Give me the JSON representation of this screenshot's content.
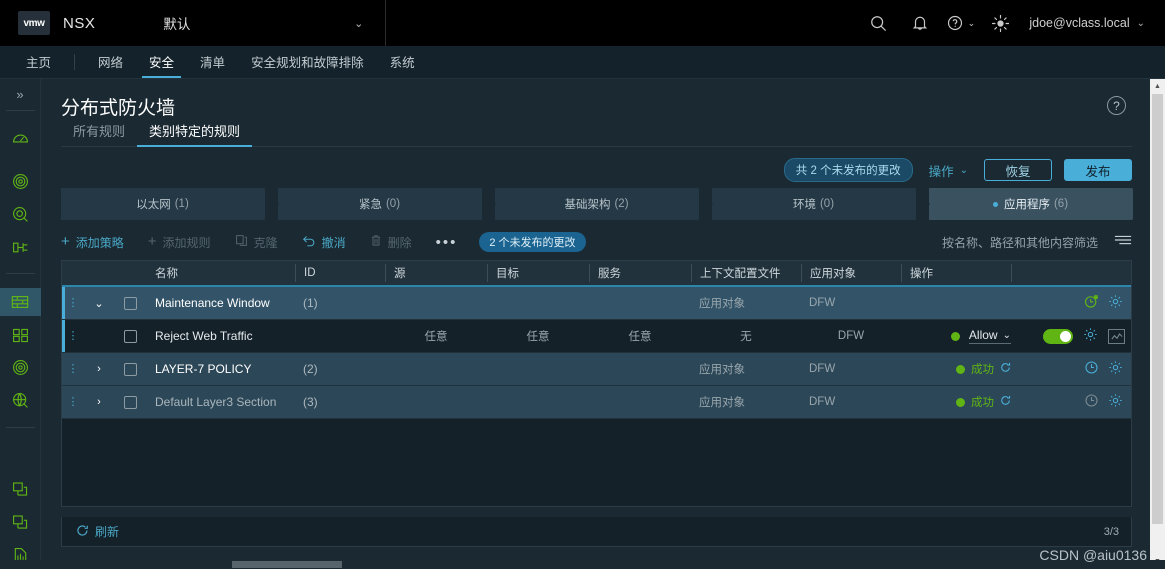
{
  "header": {
    "logo_text": "vmw",
    "app_name": "NSX",
    "context_value": "默认",
    "context_caret": "⌄",
    "icons": [
      {
        "name": "search-icon"
      },
      {
        "name": "bell-icon"
      },
      {
        "name": "help-icon"
      },
      {
        "name": "theme-icon"
      }
    ],
    "user": "jdoe@vclass.local",
    "user_caret": "⌄",
    "help_caret": "⌄"
  },
  "nav": {
    "items": [
      {
        "label": "主页",
        "active": false
      },
      {
        "label": "网络",
        "active": false
      },
      {
        "label": "安全",
        "active": true
      },
      {
        "label": "清单",
        "active": false
      },
      {
        "label": "安全规划和故障排除",
        "active": false
      },
      {
        "label": "系统",
        "active": false
      }
    ]
  },
  "sidebar": {
    "collapse_glyph": "»",
    "items": [
      {
        "name": "dashboard-icon"
      },
      {
        "name": "radar-icon"
      },
      {
        "name": "target-search-icon"
      },
      {
        "name": "flow-icon"
      },
      {
        "name": "firewall-icon",
        "active": true
      },
      {
        "name": "grid-icon"
      },
      {
        "name": "radar2-icon"
      },
      {
        "name": "discovery-icon"
      },
      {
        "name": "copy-icon"
      },
      {
        "name": "copy2-icon"
      },
      {
        "name": "report-icon"
      }
    ]
  },
  "page": {
    "title": "分布式防火墙",
    "help_glyph": "?",
    "subtabs": [
      {
        "label": "所有规则",
        "active": false
      },
      {
        "label": "类别特定的规则",
        "active": true
      }
    ]
  },
  "actionbar": {
    "unpublished_chip": "共 2 个未发布的更改",
    "operations_label": "操作",
    "operations_caret": "⌄",
    "revert_label": "恢复",
    "publish_label": "发布"
  },
  "categories": [
    {
      "label": "以太网",
      "count": "(1)",
      "selected": false,
      "dot": false
    },
    {
      "label": "紧急",
      "count": "(0)",
      "selected": false,
      "dot": false
    },
    {
      "label": "基础架构",
      "count": "(2)",
      "selected": false,
      "dot": false
    },
    {
      "label": "环境",
      "count": "(0)",
      "selected": false,
      "dot": false
    },
    {
      "label": "应用程序",
      "count": "(6)",
      "selected": true,
      "dot": true
    }
  ],
  "toolbar": {
    "add_policy": "添加策略",
    "add_rule": "添加规则",
    "clone": "克隆",
    "undo": "撤消",
    "delete": "删除",
    "more_glyph": "•••",
    "changes_chip": "2 个未发布的更改",
    "filter_placeholder": "按名称、路径和其他内容筛选",
    "filter_icon": "filter-icon"
  },
  "table": {
    "columns": [
      "名称",
      "ID",
      "源",
      "目标",
      "服务",
      "上下文配置文件",
      "应用对象",
      "操作"
    ],
    "rows": [
      {
        "type": "policy",
        "selected": true,
        "expanded": true,
        "expand_glyph": "⌄",
        "name": "Maintenance Window",
        "id": "(1)",
        "src": "",
        "dst": "",
        "svc": "",
        "ctx": "应用对象",
        "app": "DFW",
        "action": "",
        "status": "",
        "clock_color": "green"
      },
      {
        "type": "rule",
        "selected": false,
        "name": "Reject Web Traffic",
        "id": "",
        "src": "任意",
        "dst": "任意",
        "svc": "任意",
        "ctx": "无",
        "app": "DFW",
        "action": "Allow",
        "action_caret": "⌄",
        "toggle_on": true,
        "status": ""
      },
      {
        "type": "policy",
        "selected": false,
        "expanded": false,
        "expand_glyph": "›",
        "name": "LAYER-7 POLICY",
        "id": "(2)",
        "src": "",
        "dst": "",
        "svc": "",
        "ctx": "应用对象",
        "app": "DFW",
        "action": "",
        "status": "成功",
        "clock_color": "blue"
      },
      {
        "type": "policy",
        "selected": false,
        "expanded": false,
        "expand_glyph": "›",
        "name": "Default Layer3 Section",
        "id": "(3)",
        "src": "",
        "dst": "",
        "svc": "",
        "ctx": "应用对象",
        "app": "DFW",
        "action": "",
        "status": "成功",
        "clock_color": "grey"
      }
    ]
  },
  "footer": {
    "refresh_label": "刷新",
    "pager": "3/3"
  },
  "watermark": "CSDN @aiu0136",
  "colors": {
    "accent": "#49afd9",
    "green": "#60b515",
    "bg": "#1b2a32",
    "panel": "#152129"
  }
}
